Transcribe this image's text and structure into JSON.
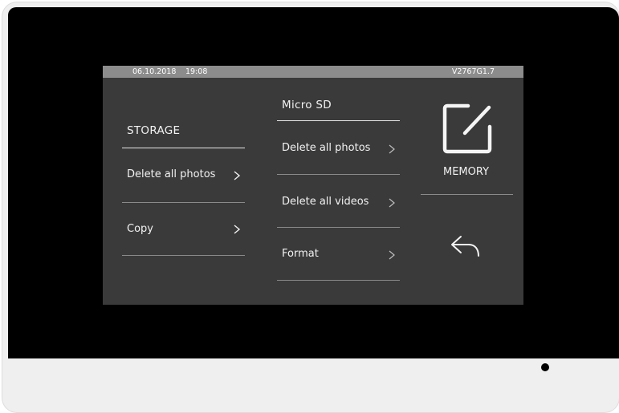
{
  "status_bar": {
    "date": "06.10.2018",
    "time": "19:08",
    "version": "V2767G1.7"
  },
  "storage_panel": {
    "title": "STORAGE",
    "items": [
      {
        "label": "Delete all photos"
      },
      {
        "label": "Copy"
      }
    ]
  },
  "microsd_panel": {
    "title": "Micro SD",
    "items": [
      {
        "label": "Delete all photos"
      },
      {
        "label": "Delete all videos"
      },
      {
        "label": "Format"
      }
    ]
  },
  "memory_panel": {
    "label": "MEMORY",
    "icon": "memory-edit-icon",
    "back_icon": "back-arrow-icon"
  },
  "colors": {
    "bezel": "#000000",
    "screen": "#3a3a3a",
    "status_bar": "#8c8c8c",
    "text": "#f2f2f2"
  }
}
